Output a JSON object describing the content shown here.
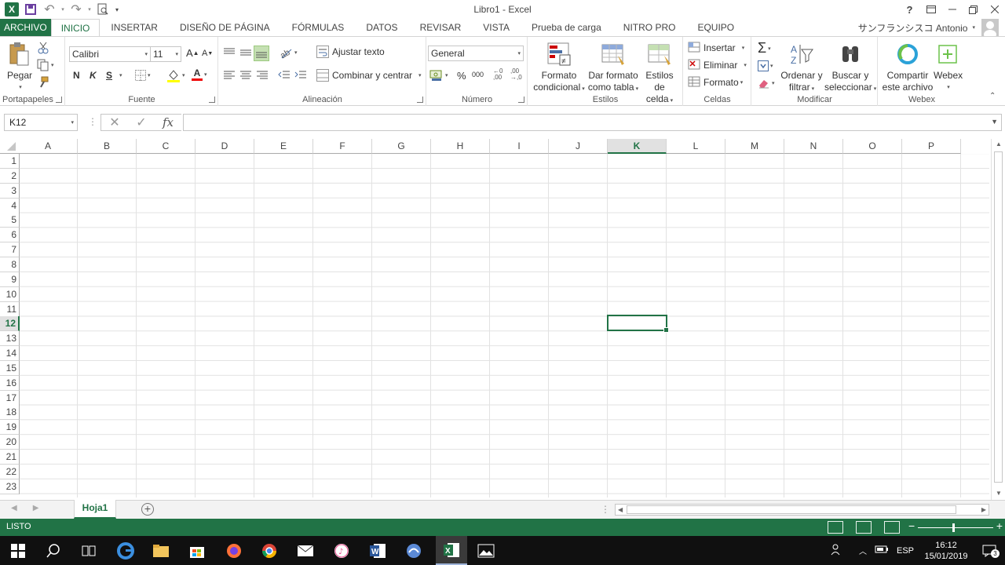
{
  "window": {
    "title": "Libro1 - Excel",
    "help_label": "?",
    "buttons": [
      "restore-ribbon",
      "minimize",
      "maximize",
      "close"
    ]
  },
  "qat": {
    "undo_arrow": "↶",
    "redo_arrow": "↷"
  },
  "tabs": [
    "ARCHIVO",
    "INICIO",
    "INSERTAR",
    "DISEÑO DE PÁGINA",
    "FÓRMULAS",
    "DATOS",
    "REVISAR",
    "VISTA",
    "Prueba de carga",
    "NITRO PRO",
    "EQUIPO"
  ],
  "active_tab": "INICIO",
  "user": {
    "name": "サンフランシスコ Antonio"
  },
  "ribbon": {
    "clipboard": {
      "label": "Portapapeles",
      "paste": "Pegar"
    },
    "font": {
      "label": "Fuente",
      "font_name": "Calibri",
      "font_size": "11",
      "bold": "N",
      "italic": "K",
      "underline": "S",
      "grow": "A",
      "shrink": "A",
      "font_color_letter": "A"
    },
    "alignment": {
      "label": "Alineación",
      "wrap_text": "Ajustar texto",
      "merge_center": "Combinar y centrar"
    },
    "number": {
      "label": "Número",
      "format": "General",
      "percent": "%",
      "thousands": "000",
      "inc_decimal": "←0\n,00",
      "dec_decimal": ",00\n→,0"
    },
    "styles": {
      "label": "Estilos",
      "conditional_l1": "Formato",
      "conditional_l2": "condicional",
      "table_l1": "Dar formato",
      "table_l2": "como tabla",
      "cell_l1": "Estilos de",
      "cell_l2": "celda"
    },
    "cells": {
      "label": "Celdas",
      "insert": "Insertar",
      "delete": "Eliminar",
      "format": "Formato"
    },
    "editing": {
      "label": "Modificar",
      "sort_l1": "Ordenar y",
      "sort_l2": "filtrar",
      "find_l1": "Buscar y",
      "find_l2": "seleccionar"
    },
    "webex": {
      "label": "Webex",
      "share_l1": "Compartir",
      "share_l2": "este archivo",
      "webex": "Webex"
    }
  },
  "formula_bar": {
    "name_box": "K12",
    "fx": "fx",
    "value": ""
  },
  "sheet": {
    "columns": [
      "A",
      "B",
      "C",
      "D",
      "E",
      "F",
      "G",
      "H",
      "I",
      "J",
      "K",
      "L",
      "M",
      "N",
      "O",
      "P"
    ],
    "rows": [
      "1",
      "2",
      "3",
      "4",
      "5",
      "6",
      "7",
      "8",
      "9",
      "10",
      "11",
      "12",
      "13",
      "14",
      "15",
      "16",
      "17",
      "18",
      "19",
      "20",
      "21",
      "22",
      "23"
    ],
    "selected_column": "K",
    "selected_row": "12"
  },
  "sheet_tabs": [
    "Hoja1"
  ],
  "status": {
    "text": "LISTO"
  },
  "taskbar": {
    "language": "ESP",
    "time": "16:12",
    "date": "15/01/2019",
    "notifications": "3"
  },
  "colors": {
    "excel_green": "#217346",
    "grid_line": "#e2e2e2"
  }
}
